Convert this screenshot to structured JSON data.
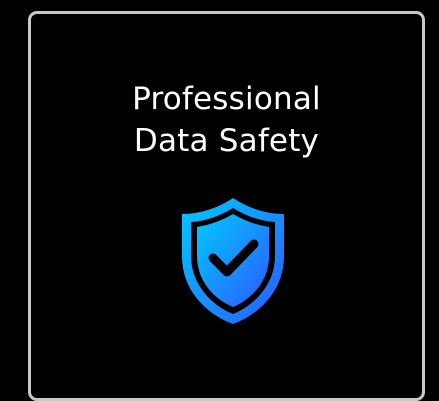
{
  "card": {
    "title_line1": "Professional",
    "title_line2": "Data Safety",
    "icon": "shield-check-icon"
  },
  "colors": {
    "background": "#000000",
    "card_border": "#c8c8c8",
    "title_text": "#ffffff",
    "shield_gradient_start": "#00b4ff",
    "shield_gradient_end": "#1e5cff",
    "checkmark": "#000000"
  }
}
